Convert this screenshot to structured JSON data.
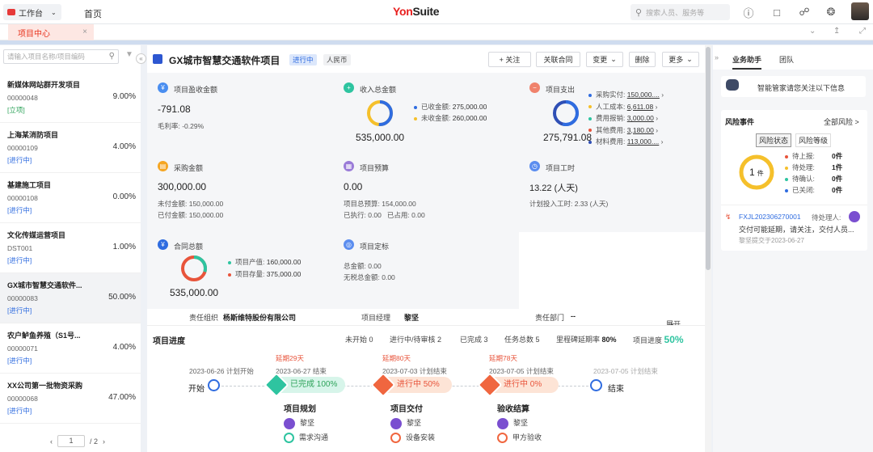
{
  "topbar": {
    "workspace_label": "工作台",
    "home_label": "首页",
    "logo_red": "Yon",
    "logo_dark": "Suite",
    "search_placeholder": "搜索人员、服务等"
  },
  "tabbar": {
    "active_tab": "项目中心"
  },
  "sidebar": {
    "search_placeholder": "请输入项目名称/项目编码",
    "items": [
      {
        "name": "新媒体网站群开发项目",
        "code": "00000048",
        "percent": "9.00%",
        "status": "[立项]"
      },
      {
        "name": "上海某消防项目",
        "code": "00000109",
        "percent": "4.00%",
        "status": "[进行中]"
      },
      {
        "name": "基建施工项目",
        "code": "00000108",
        "percent": "0.00%",
        "status": "[进行中]"
      },
      {
        "name": "文化传媒运营项目",
        "code": "DST001",
        "percent": "1.00%",
        "status": "[进行中]"
      },
      {
        "name": "GX城市智慧交通软件...",
        "code": "00000083",
        "percent": "50.00%",
        "status": "[进行中]"
      },
      {
        "name": "农户鲈鱼养殖（S1号...",
        "code": "00000071",
        "percent": "4.00%",
        "status": "[进行中]"
      },
      {
        "name": "XX公司第一批物资采购",
        "code": "00000068",
        "percent": "47.00%",
        "status": "[进行中]"
      }
    ],
    "pager_value": "1",
    "pager_total": "/ 2"
  },
  "header": {
    "title": "GX城市智慧交通软件项目",
    "status_badge": "进行中",
    "currency_badge": "人民币",
    "buttons": {
      "follow": "+ 关注",
      "contract": "关联合同",
      "change": "变更",
      "delete": "删除",
      "more": "更多"
    }
  },
  "metrics": {
    "profit": {
      "label": "项目盈收金额",
      "value": "-791.08",
      "sub": "毛利率: -0.29%"
    },
    "income": {
      "label": "收入总金额",
      "total": "535,000.00",
      "received_label": "已收金额:",
      "received": "275,000.00",
      "pending_label": "未收金额:",
      "pending": "260,000.00",
      "received_share": 0.514
    },
    "expense": {
      "label": "项目支出",
      "total": "275,791.08",
      "items": [
        {
          "label": "采购实付:",
          "value": "150,000....",
          "color": "#2f6ce0"
        },
        {
          "label": "人工成本:",
          "value": "6,611.08",
          "color": "#f5c02b"
        },
        {
          "label": "费用报销:",
          "value": "3,000.00",
          "color": "#2ec4a0"
        },
        {
          "label": "其他费用:",
          "value": "3,180.00",
          "color": "#e8543b"
        },
        {
          "label": "材料费用:",
          "value": "113,000....",
          "color": "#2f4fb5"
        }
      ]
    },
    "purchase": {
      "label": "采购金额",
      "value": "300,000.00",
      "unpaid": "未付金额: 150,000.00",
      "paid": "已付金额: 150,000.00"
    },
    "budget": {
      "label": "项目预算",
      "value": "0.00",
      "total": "项目总预算: 154,000.00",
      "exec_label": "已执行:",
      "exec": "0.00",
      "used_label": "已占用:",
      "used": "0.00"
    },
    "hours": {
      "label": "项目工时",
      "value": "13.22 (人天)",
      "sub": "计划投入工时: 2.33 (人天)"
    },
    "contract": {
      "label": "合同总额",
      "total": "535,000.00",
      "output_label": "项目产值:",
      "output": "160,000.00",
      "stock_label": "项目存量:",
      "stock": "375,000.00",
      "output_share": 0.299
    },
    "pricing": {
      "label": "项目定标",
      "total": "总金额: 0.00",
      "notax": "无税总金额: 0.00"
    }
  },
  "infobar": {
    "org_label": "责任组织",
    "org": "杨斯维特股份有限公司",
    "manager_label": "项目经理",
    "manager": "黎坚",
    "dept_label": "责任部门",
    "dept": "--",
    "expand": "展开"
  },
  "progress": {
    "title": "项目进度",
    "not_started": "未开始 0",
    "in_progress": "进行中/待审核 2",
    "done": "已完成 3",
    "tasks": "任务总数 5",
    "milestone_rate_label": "里程碑延期率",
    "milestone_rate": "80%",
    "progress_label": "项目进度",
    "progress_value": "50%",
    "nodes": [
      {
        "date": "2023-06-26 计划开始",
        "label": "开始"
      },
      {
        "delay": "延期29天",
        "date": "2023-06-27 结束",
        "pill": "已完成 100%",
        "name": "项目规划",
        "person": "黎坚",
        "sub": "需求沟通"
      },
      {
        "delay": "延期80天",
        "date": "2023-07-03 计划结束",
        "pill": "进行中 50%",
        "name": "项目交付",
        "person": "黎坚",
        "sub": "设备安装"
      },
      {
        "delay": "延期78天",
        "date": "2023-07-05 计划结束",
        "pill": "进行中 0%",
        "name": "验收结算",
        "person": "黎坚",
        "sub": "甲方验收"
      },
      {
        "date": "2023-07-05 计划结束",
        "label": "结束"
      }
    ]
  },
  "assistant": {
    "tab_active": "业务助手",
    "tab_team": "团队",
    "greeting": "智能管家请您关注以下信息",
    "risk_title": "风险事件",
    "risk_all": "全部风险 >",
    "risk_tab_status": "风险状态",
    "risk_tab_level": "风险等级",
    "risk_count": "1",
    "risk_unit": "件",
    "risk_legend": [
      {
        "label": "待上报:",
        "value": "0件",
        "color": "#e8543b"
      },
      {
        "label": "待处理:",
        "value": "1件",
        "color": "#f5c02b"
      },
      {
        "label": "待确认:",
        "value": "0件",
        "color": "#2ec4a0"
      },
      {
        "label": "已关闭:",
        "value": "0件",
        "color": "#2f6ce0"
      }
    ],
    "event_code": "FXJL202306270001",
    "event_handler_label": "待处理人:",
    "event_text": "交付可能延期，请关注，交付人员...",
    "event_meta": "黎坚提交于2023-06-27"
  }
}
